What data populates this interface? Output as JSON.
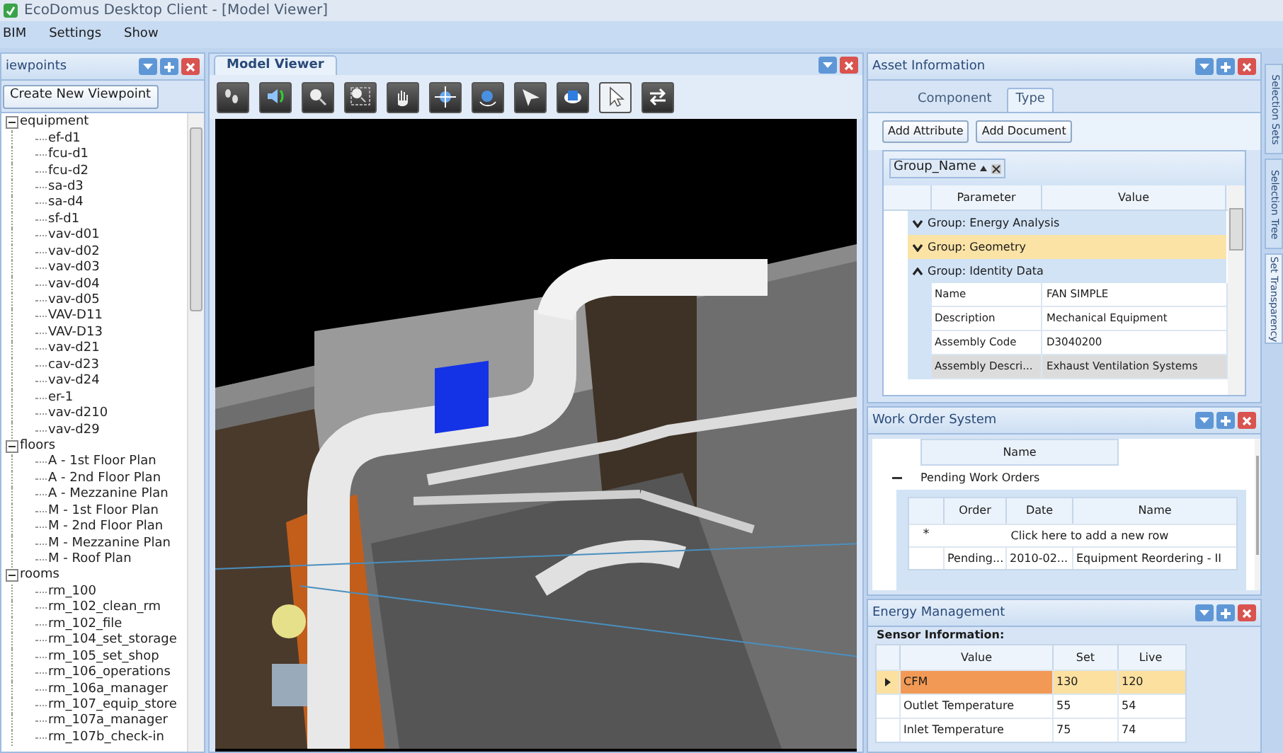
{
  "window": {
    "title": "EcoDomus Desktop Client - [Model Viewer]"
  },
  "menu": [
    "BIM",
    "Settings",
    "Show"
  ],
  "viewpoints": {
    "title": "iewpoints",
    "button": "Create New Viewpoint",
    "tree": [
      {
        "label": "equipment",
        "expanded": true,
        "children": [
          {
            "label": "ef-d1"
          },
          {
            "label": "fcu-d1"
          },
          {
            "label": "fcu-d2"
          },
          {
            "label": "sa-d3"
          },
          {
            "label": "sa-d4"
          },
          {
            "label": "sf-d1"
          },
          {
            "label": "vav-d01"
          },
          {
            "label": "vav-d02"
          },
          {
            "label": "vav-d03"
          },
          {
            "label": "vav-d04"
          },
          {
            "label": "vav-d05"
          },
          {
            "label": "VAV-D11"
          },
          {
            "label": "VAV-D13"
          },
          {
            "label": "vav-d21"
          },
          {
            "label": "cav-d23"
          },
          {
            "label": "vav-d24"
          },
          {
            "label": "er-1"
          },
          {
            "label": "vav-d210"
          },
          {
            "label": "vav-d29"
          }
        ]
      },
      {
        "label": "floors",
        "expanded": true,
        "children": [
          {
            "label": "A - 1st Floor Plan"
          },
          {
            "label": "A - 2nd Floor Plan"
          },
          {
            "label": "A - Mezzanine Plan"
          },
          {
            "label": "M - 1st Floor Plan"
          },
          {
            "label": "M - 2nd Floor Plan"
          },
          {
            "label": "M - Mezzanine Plan"
          },
          {
            "label": "M - Roof Plan"
          }
        ]
      },
      {
        "label": "rooms",
        "expanded": true,
        "children": [
          {
            "label": "rm_100"
          },
          {
            "label": "rm_102_clean_rm"
          },
          {
            "label": "rm_102_file"
          },
          {
            "label": "rm_104_set_storage"
          },
          {
            "label": "rm_105_set_shop"
          },
          {
            "label": "rm_106_operations"
          },
          {
            "label": "rm_106a_manager"
          },
          {
            "label": "rm_107_equip_store"
          },
          {
            "label": "rm_107a_manager"
          },
          {
            "label": "rm_107b_check-in"
          }
        ]
      }
    ]
  },
  "model_viewer": {
    "tab": "Model Viewer",
    "tools": [
      {
        "kind": "walk",
        "selected": false
      },
      {
        "kind": "look",
        "selected": false
      },
      {
        "kind": "zoom",
        "selected": false
      },
      {
        "kind": "zoom_box",
        "selected": false
      },
      {
        "kind": "pan",
        "selected": false
      },
      {
        "kind": "orbit",
        "selected": false
      },
      {
        "kind": "rotate",
        "selected": false
      },
      {
        "kind": "fly",
        "selected": false
      },
      {
        "kind": "view",
        "selected": false
      },
      {
        "kind": "select",
        "selected": true
      },
      {
        "kind": "swap",
        "selected": false
      }
    ]
  },
  "asset_information": {
    "title": "Asset Information",
    "tabs": [
      {
        "label": "Component",
        "selected": false
      },
      {
        "label": "Type",
        "selected": true
      }
    ],
    "buttons": [
      "Add Attribute",
      "Add Document"
    ],
    "group_by": "Group_Name",
    "columns": [
      "Parameter",
      "Value"
    ],
    "groups": [
      {
        "label": "Group: Energy Analysis",
        "expanded": false,
        "selected": false
      },
      {
        "label": "Group: Geometry",
        "expanded": false,
        "selected": true
      },
      {
        "label": "Group: Identity Data",
        "expanded": true,
        "selected": false,
        "rows": [
          {
            "parameter": "Name",
            "value": "FAN SIMPLE",
            "selected": false
          },
          {
            "parameter": "Description",
            "value": "Mechanical Equipment",
            "selected": false
          },
          {
            "parameter": "Assembly Code",
            "value": "D3040200",
            "selected": false
          },
          {
            "parameter": "Assembly Descri...",
            "value": "Exhaust Ventilation Systems",
            "selected": true
          }
        ]
      }
    ]
  },
  "side_tabs": [
    {
      "label": "Selection Sets",
      "selected": false
    },
    {
      "label": "Selection Tree",
      "selected": false
    },
    {
      "label": "Set Transparency",
      "selected": true
    }
  ],
  "work_order_system": {
    "title": "Work Order System",
    "column": "Name",
    "group": {
      "label": "Pending Work Orders",
      "expanded": true
    },
    "columns": [
      "Order",
      "Date",
      "Name"
    ],
    "new_row_marker": "*",
    "new_row": "Click here to add a new row",
    "rows": [
      {
        "cells": [
          "Pending...",
          "2010-02...",
          "Equipment Reordering - II"
        ]
      }
    ]
  },
  "energy_management": {
    "title": "Energy Management",
    "subtitle": "Sensor Information:",
    "columns": [
      "Value",
      "Set",
      "Live"
    ],
    "rows": [
      {
        "cells": [
          "CFM",
          "130",
          "120"
        ],
        "selected": true
      },
      {
        "cells": [
          "Outlet Temperature",
          "55",
          "54"
        ],
        "selected": false
      },
      {
        "cells": [
          "Inlet Temperature",
          "75",
          "74"
        ],
        "selected": false
      }
    ]
  }
}
